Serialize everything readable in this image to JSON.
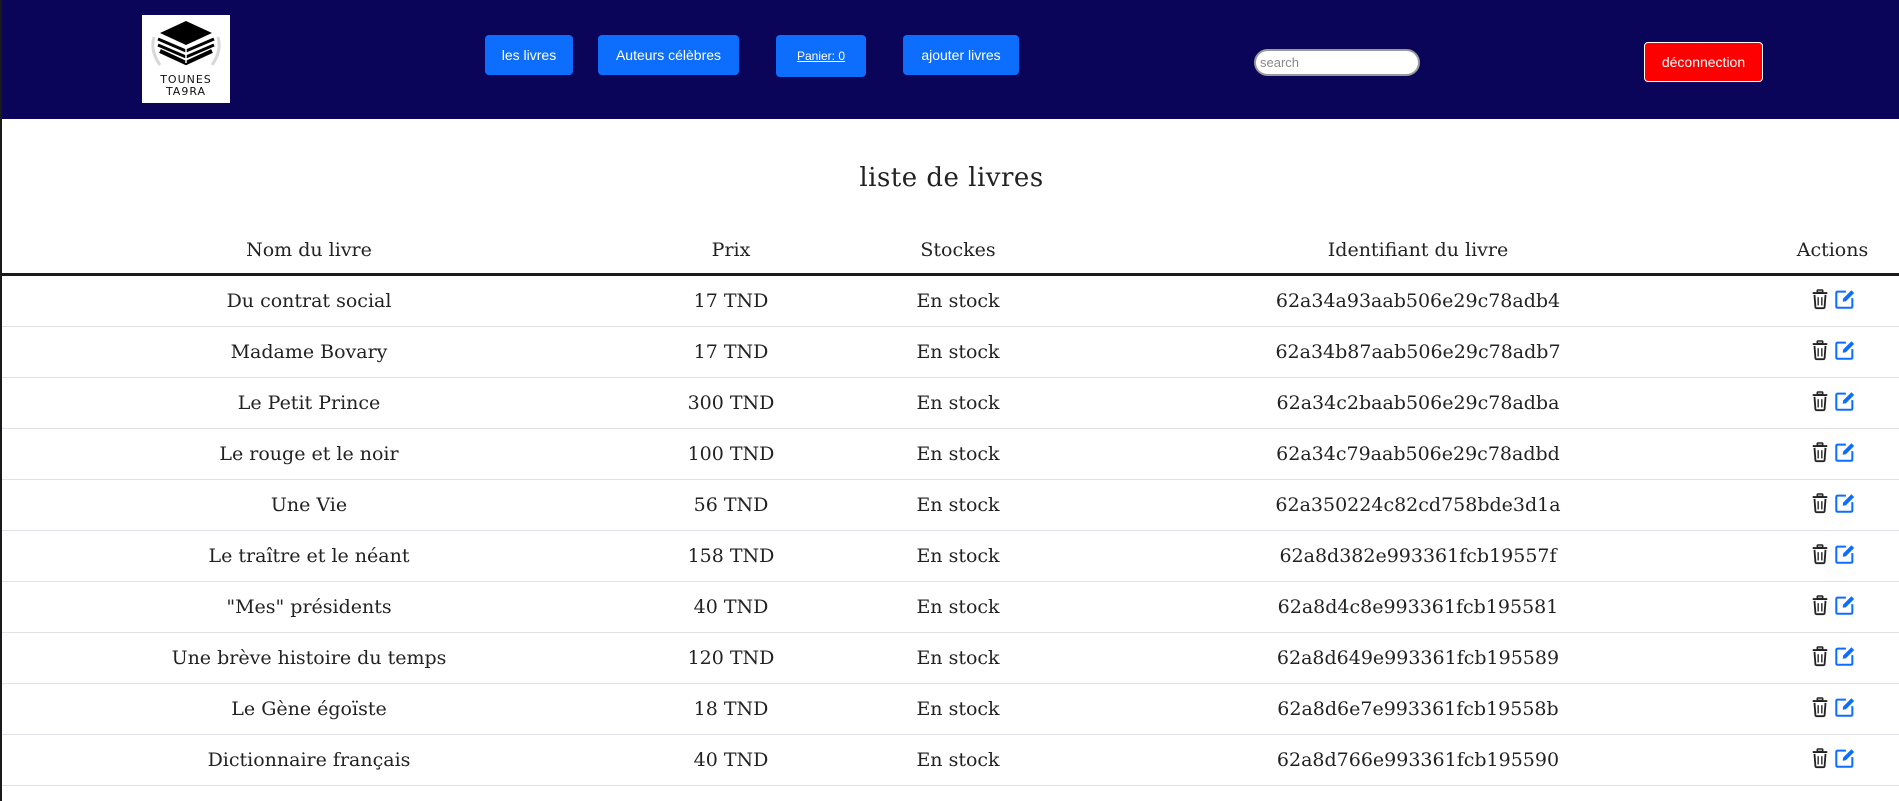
{
  "header": {
    "logo_text_line1": "TOUNES",
    "logo_text_line2": "TA9RA",
    "nav": {
      "books_label": "les livres",
      "authors_label": "Auteurs célèbres",
      "cart_label": "Panier: 0",
      "add_books_label": "ajouter livres"
    },
    "search": {
      "placeholder": "search",
      "value": ""
    },
    "logout_label": "déconnection"
  },
  "colors": {
    "header_bg": "#0b0559",
    "button_blue": "#0d6efd",
    "logout_red": "#ff0000",
    "edit_icon_blue": "#0d6efd"
  },
  "main": {
    "title": "liste de livres",
    "table": {
      "columns": [
        "Nom du livre",
        "Prix",
        "Stockes",
        "Identifiant du livre",
        "Actions"
      ],
      "rows": [
        {
          "name": "Du contrat social",
          "price": "17 TND",
          "stock": "En stock",
          "id": "62a34a93aab506e29c78adb4"
        },
        {
          "name": "Madame Bovary",
          "price": "17 TND",
          "stock": "En stock",
          "id": "62a34b87aab506e29c78adb7"
        },
        {
          "name": "Le Petit Prince",
          "price": "300 TND",
          "stock": "En stock",
          "id": "62a34c2baab506e29c78adba"
        },
        {
          "name": "Le rouge et le noir",
          "price": "100 TND",
          "stock": "En stock",
          "id": "62a34c79aab506e29c78adbd"
        },
        {
          "name": "Une Vie",
          "price": "56 TND",
          "stock": "En stock",
          "id": "62a350224c82cd758bde3d1a"
        },
        {
          "name": "Le traître et le néant",
          "price": "158 TND",
          "stock": "En stock",
          "id": "62a8d382e993361fcb19557f"
        },
        {
          "name": "\"Mes\" présidents",
          "price": "40 TND",
          "stock": "En stock",
          "id": "62a8d4c8e993361fcb195581"
        },
        {
          "name": "Une brève histoire du temps",
          "price": "120 TND",
          "stock": "En stock",
          "id": "62a8d649e993361fcb195589"
        },
        {
          "name": "Le Gène égoïste",
          "price": "18 TND",
          "stock": "En stock",
          "id": "62a8d6e7e993361fcb19558b"
        },
        {
          "name": "Dictionnaire français",
          "price": "40 TND",
          "stock": "En stock",
          "id": "62a8d766e993361fcb195590"
        }
      ],
      "row_icons": [
        "trash-icon",
        "edit-icon"
      ]
    }
  }
}
